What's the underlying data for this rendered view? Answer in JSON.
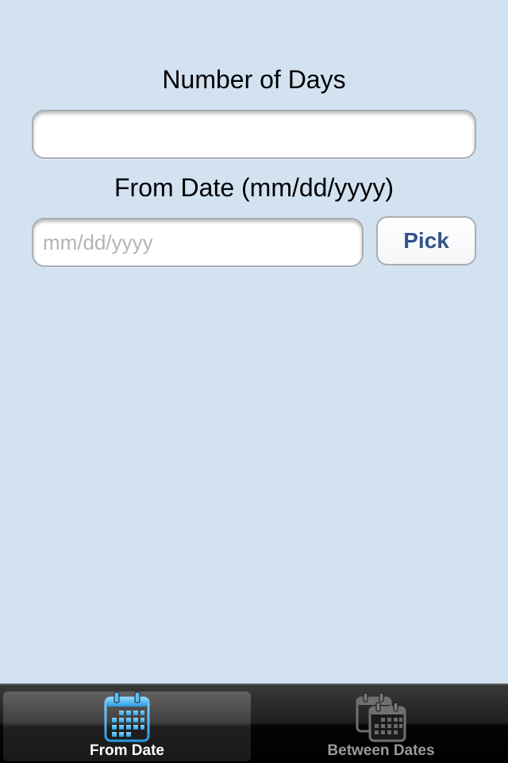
{
  "form": {
    "days_label": "Number of Days",
    "days_value": "",
    "from_label": "From Date (mm/dd/yyyy)",
    "from_placeholder": "mm/dd/yyyy",
    "pick_label": "Pick"
  },
  "tabbar": {
    "tabs": [
      {
        "label": "From Date",
        "icon": "calendar-icon",
        "active": true
      },
      {
        "label": "Between Dates",
        "icon": "calendars-icon",
        "active": false
      }
    ]
  },
  "colors": {
    "background": "#d2e2f1",
    "button_text": "#34538a",
    "tab_active_icon": "#4fb4ec"
  }
}
